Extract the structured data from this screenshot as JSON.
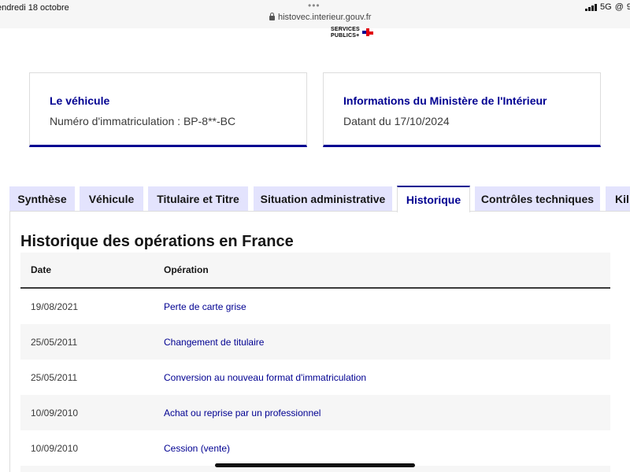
{
  "status_bar": {
    "date": "endredi 18 octobre",
    "url": "histovec.interieur.gouv.fr",
    "network": "5G",
    "battery_partial": "9"
  },
  "logo": {
    "line1": "SERVICES",
    "line2": "PUBLICS+"
  },
  "cards": [
    {
      "title": "Le véhicule",
      "subtitle": "Numéro d'immatriculation : BP-8**-BC"
    },
    {
      "title": "Informations du Ministère de l'Intérieur",
      "subtitle": "Datant du 17/10/2024"
    }
  ],
  "tabs": [
    {
      "label": "Synthèse",
      "active": false
    },
    {
      "label": "Véhicule",
      "active": false
    },
    {
      "label": "Titulaire et Titre",
      "active": false
    },
    {
      "label": "Situation administrative",
      "active": false
    },
    {
      "label": "Historique",
      "active": true
    },
    {
      "label": "Contrôles techniques",
      "active": false
    },
    {
      "label": "Kil",
      "active": false
    }
  ],
  "section_title": "Historique des opérations en France",
  "table": {
    "headers": [
      "Date",
      "Opération"
    ],
    "rows": [
      {
        "date": "19/08/2021",
        "operation": "Perte de carte grise"
      },
      {
        "date": "25/05/2011",
        "operation": "Changement de titulaire"
      },
      {
        "date": "25/05/2011",
        "operation": "Conversion au nouveau format d'immatriculation"
      },
      {
        "date": "10/09/2010",
        "operation": "Achat ou reprise par un professionnel"
      },
      {
        "date": "10/09/2010",
        "operation": "Cession (vente)"
      }
    ]
  },
  "colors": {
    "primary_blue": "#000091",
    "tab_bg": "#e3e3fd",
    "row_alt": "#f6f6f6"
  }
}
